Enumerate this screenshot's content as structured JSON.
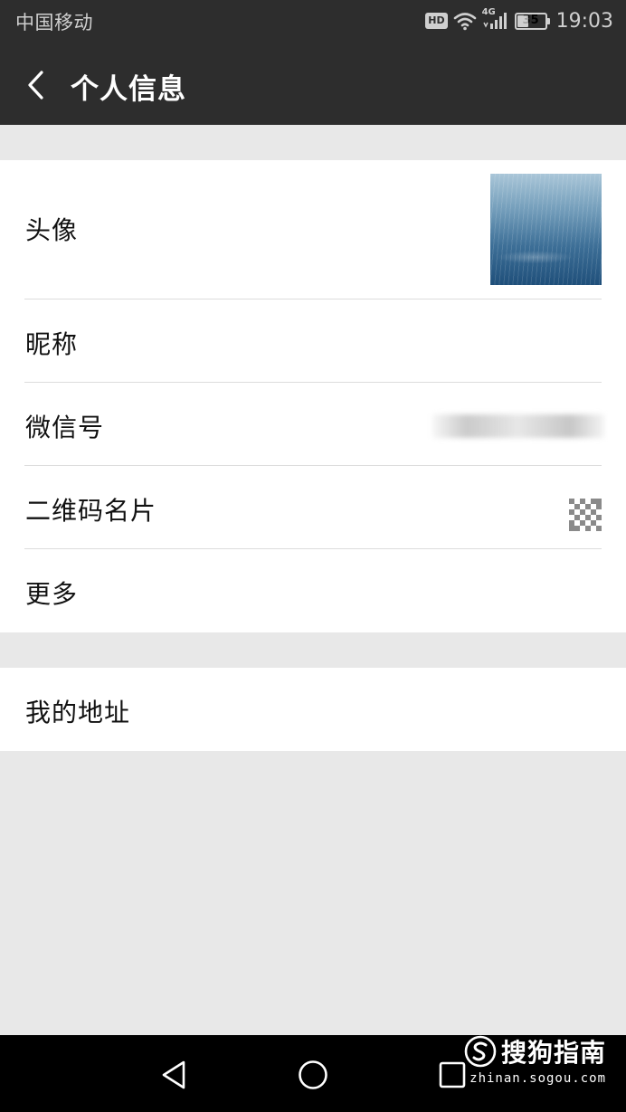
{
  "status_bar": {
    "carrier": "中国移动",
    "hd": "HD",
    "network": "4G",
    "battery": "35",
    "time": "19:03",
    "icons": [
      "hd-icon",
      "wifi-icon",
      "signal-icon",
      "battery-icon"
    ]
  },
  "header": {
    "back_icon": "chevron-left-icon",
    "title": "个人信息"
  },
  "profile": {
    "avatar_label": "头像",
    "nickname_label": "昵称",
    "wechat_id_label": "微信号",
    "qr_label": "二维码名片",
    "qr_icon": "qr-code-icon",
    "more_label": "更多",
    "address_label": "我的地址"
  },
  "nav_bar": {
    "icons": [
      "back-triangle-icon",
      "home-circle-icon",
      "recents-square-icon"
    ]
  },
  "watermark": {
    "logo_text": "搜狗指南",
    "url": "zhinan.sogou.com"
  },
  "colors": {
    "header_bg": "#2d2d2d",
    "page_bg": "#e8e8e8",
    "list_bg": "#ffffff",
    "divider": "#dcdcdc",
    "nav_bg": "#000000"
  }
}
